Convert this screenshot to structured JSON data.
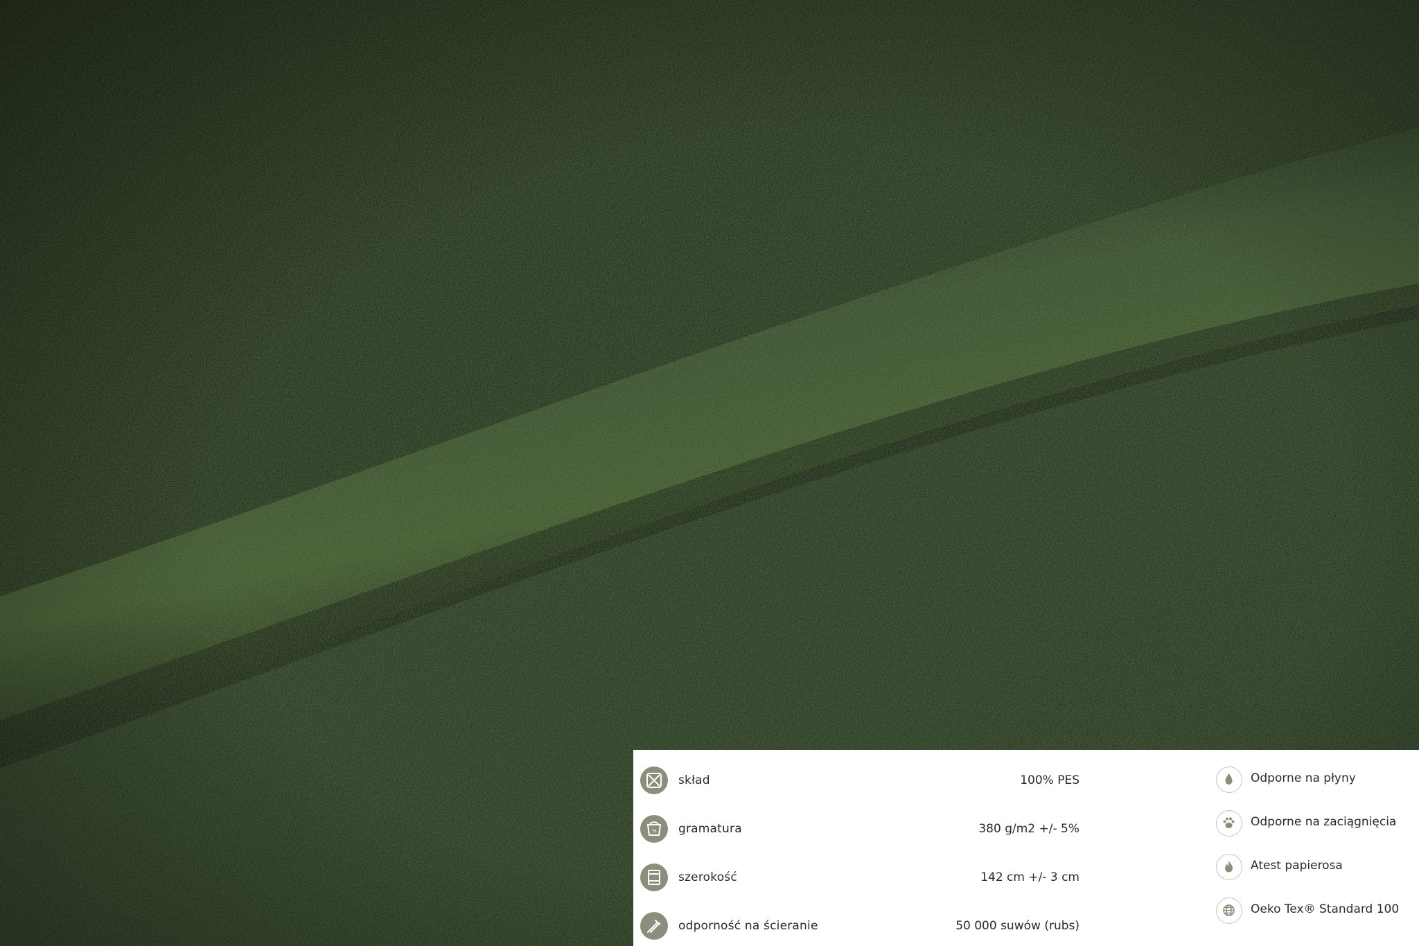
{
  "specs": [
    {
      "label": "skład",
      "value": "100% PES",
      "icon": "composition-icon"
    },
    {
      "label": "gramatura",
      "value": "380 g/m2 +/- 5%",
      "icon": "weight-scale-icon"
    },
    {
      "label": "szerokość",
      "value": "142 cm +/- 3 cm",
      "icon": "width-roll-icon"
    },
    {
      "label": "odporność na ścieranie",
      "value": "50 000 suwów (rubs)",
      "icon": "abrasion-icon"
    }
  ],
  "features": [
    {
      "label": "Odporne na płyny",
      "icon": "droplet-icon"
    },
    {
      "label": "Odporne na zaciągnięcia",
      "icon": "paw-icon"
    },
    {
      "label": "Atest papierosa",
      "icon": "flame-icon"
    },
    {
      "label": "Oeko Tex® Standard 100",
      "icon": "globe-icon"
    }
  ],
  "colors": {
    "fabric_dark": "#16200f",
    "fabric_mid": "#2a3a1f",
    "fabric_highlight": "#3f5a2a",
    "icon_fill": "#8a8f7c",
    "panel_bg": "#ffffff",
    "text": "#2b2b2b"
  }
}
